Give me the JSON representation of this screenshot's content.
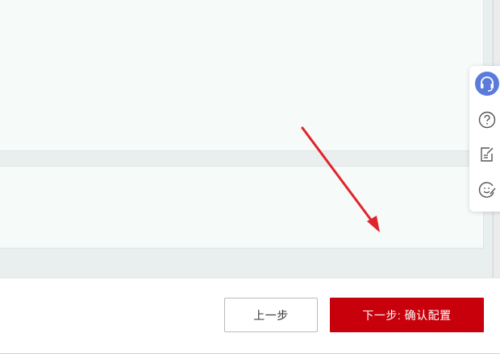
{
  "footer": {
    "prev_label": "上一步",
    "next_label": "下一步: 确认配置"
  },
  "float_toolbar": {
    "icons": [
      "headset-icon",
      "help-icon",
      "feedback-edit-icon",
      "satisfaction-icon"
    ]
  },
  "colors": {
    "primary": "#c7000b",
    "support_icon": "#5a7bdc",
    "annotation_arrow": "#e0242d"
  }
}
